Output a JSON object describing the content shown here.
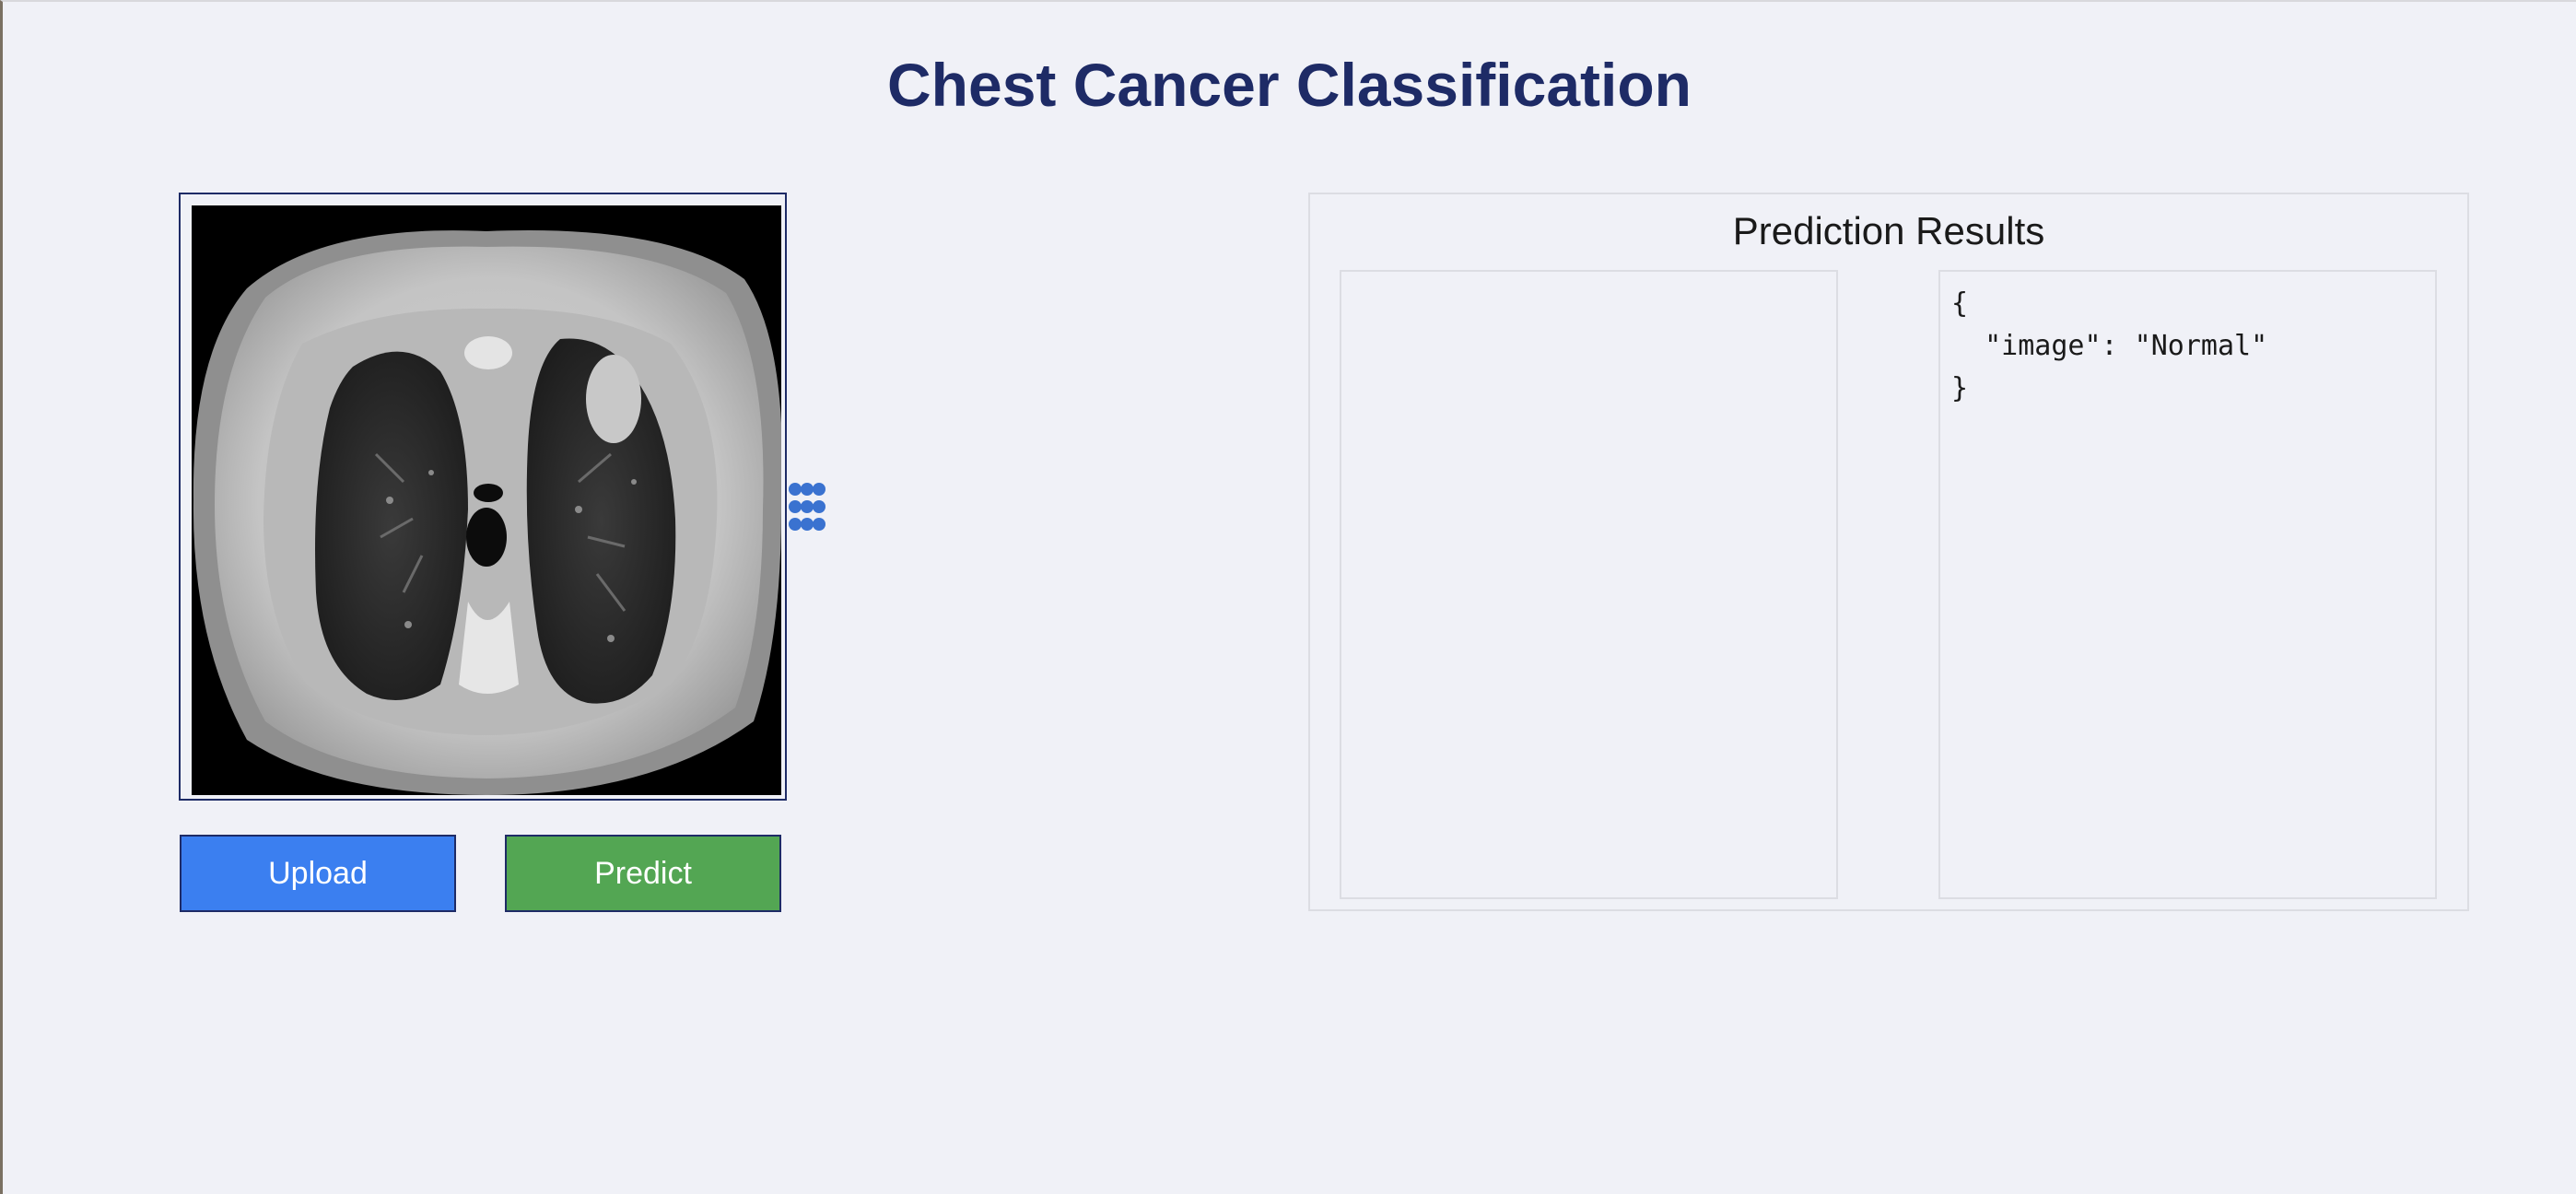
{
  "page": {
    "title": "Chest Cancer Classification"
  },
  "image_panel": {
    "image_alt": "CT scan"
  },
  "buttons": {
    "upload_label": "Upload",
    "predict_label": "Predict"
  },
  "results": {
    "title": "Prediction Results",
    "json_output": "{\n  \"image\": \"Normal\"\n}"
  },
  "colors": {
    "title": "#1e2b66",
    "upload_button": "#3b7ff0",
    "predict_button": "#53a653",
    "background": "#f0f1f7",
    "spinner": "#3a72d0"
  },
  "icons": {
    "loading": "loading-dots-icon"
  }
}
